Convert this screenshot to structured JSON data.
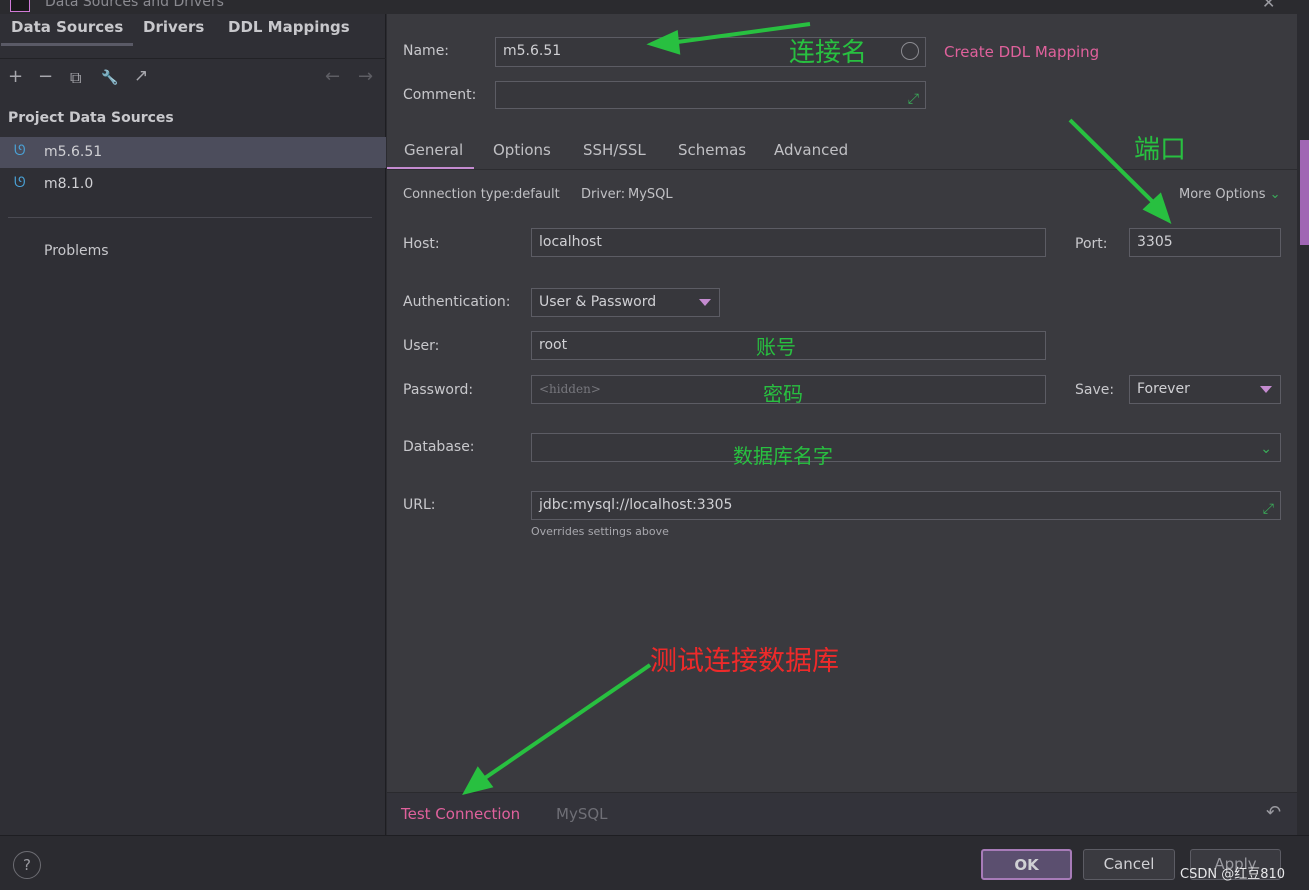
{
  "window": {
    "title": "Data Sources and Drivers",
    "close_glyph": "✕"
  },
  "left_tabs": [
    "Data Sources",
    "Drivers",
    "DDL Mappings"
  ],
  "toolbar": {
    "add": "+",
    "remove": "−",
    "copy": "⧉",
    "wrench": "🔧",
    "goto": "↗",
    "back": "←",
    "forward": "→"
  },
  "tree": {
    "section": "Project Data Sources",
    "items": [
      {
        "label": "m5.6.51",
        "selected": true
      },
      {
        "label": "m8.1.0",
        "selected": false
      }
    ],
    "problems": "Problems"
  },
  "header": {
    "name_label": "Name:",
    "name_value": "m5.6.51",
    "create_ddl": "Create DDL Mapping",
    "comment_label": "Comment:",
    "comment_value": ""
  },
  "tabs": [
    "General",
    "Options",
    "SSH/SSL",
    "Schemas",
    "Advanced"
  ],
  "general": {
    "connection_type_label": "Connection type:",
    "connection_type_value": "default",
    "driver_label": "Driver:",
    "driver_value": "MySQL",
    "more_options": "More Options",
    "host_label": "Host:",
    "host_value": "localhost",
    "port_label": "Port:",
    "port_value": "3305",
    "auth_label": "Authentication:",
    "auth_value": "User & Password",
    "user_label": "User:",
    "user_value": "root",
    "password_label": "Password:",
    "password_placeholder": "<hidden>",
    "save_label": "Save:",
    "save_value": "Forever",
    "database_label": "Database:",
    "database_value": "",
    "url_label": "URL:",
    "url_value": "jdbc:mysql://localhost:3305",
    "url_hint": "Overrides settings above"
  },
  "bottom": {
    "test_connection": "Test Connection",
    "driver_link": "MySQL",
    "revert_glyph": "↶"
  },
  "footer": {
    "help": "?",
    "ok": "OK",
    "cancel": "Cancel",
    "apply": "Apply",
    "watermark": "CSDN @红豆810"
  },
  "annotations": {
    "connection_name": "连接名",
    "port": "端口",
    "account": "账号",
    "password": "密码",
    "database_name": "数据库名字",
    "test_connection": "测试连接数据库"
  },
  "colors": {
    "accent_pink": "#e0619c",
    "accent_purple": "#c48bd0",
    "annotation_green": "#28c040",
    "annotation_red": "#ee2a2a"
  }
}
